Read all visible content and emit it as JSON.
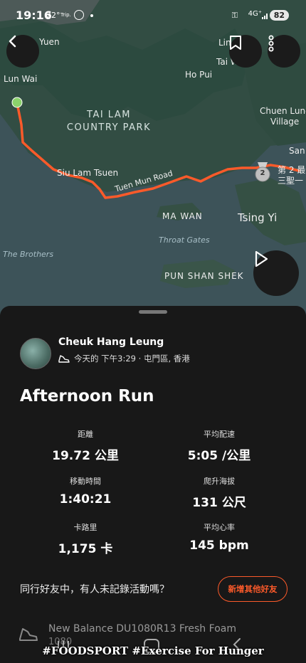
{
  "status_bar": {
    "time": "19:16",
    "temp": "22°",
    "trip": "Trip.",
    "network": "4G⁺",
    "battery": "82"
  },
  "map": {
    "labels": {
      "yuen": "Yuen",
      "lun_wai": "Lun Wai",
      "lin": "Lin",
      "tai_w": "Tai W",
      "ho_pui": "Ho Pui",
      "chuen_lung": "Chuen Lung",
      "village": "Village",
      "san": "San",
      "park_line1": "TAI LAM",
      "park_line2": "COUNTRY PARK",
      "siu_lam": "Siu Lam Tsuen",
      "tuen_mun_road": "Tuen Mun Road",
      "ma_wan": "MA WAN",
      "throat_gates": "Throat Gates",
      "tsing_yi": "Tsing Yi",
      "the_brothers": "The Brothers",
      "pun_shan_shek": "PUN SHAN SHEK",
      "segment_rank": "第 2 最",
      "segment_name": "三聖一",
      "medal_number": "2"
    },
    "route_color": "#fc5a2a",
    "start_color": "#8bd16b"
  },
  "activity": {
    "athlete_name": "Cheuk Hang Leung",
    "meta": "今天的 下午3:29 · 屯門區, 香港",
    "title": "Afternoon Run",
    "stats": {
      "distance": {
        "label": "距離",
        "value": "19.72 公里"
      },
      "pace": {
        "label": "平均配速",
        "value": "5:05 /公里"
      },
      "moving_time": {
        "label": "移動時間",
        "value": "1:40:21"
      },
      "elevation": {
        "label": "爬升海拔",
        "value": "131 公尺"
      },
      "calories": {
        "label": "卡路里",
        "value": "1,175 卡"
      },
      "heart_rate": {
        "label": "平均心率",
        "value": "145 bpm"
      }
    },
    "friends_prompt": "同行好友中，有人未記錄活動嗎？",
    "add_friends_button": "新增其他好友",
    "gear_name": "New Balance DU1080R13 Fresh Foam",
    "gear_distance": "1080"
  },
  "footer_caption": "#FOODSPORT #Exercise For Hunger",
  "colors": {
    "accent": "#fc5a2a",
    "sheet_bg": "#181818"
  }
}
